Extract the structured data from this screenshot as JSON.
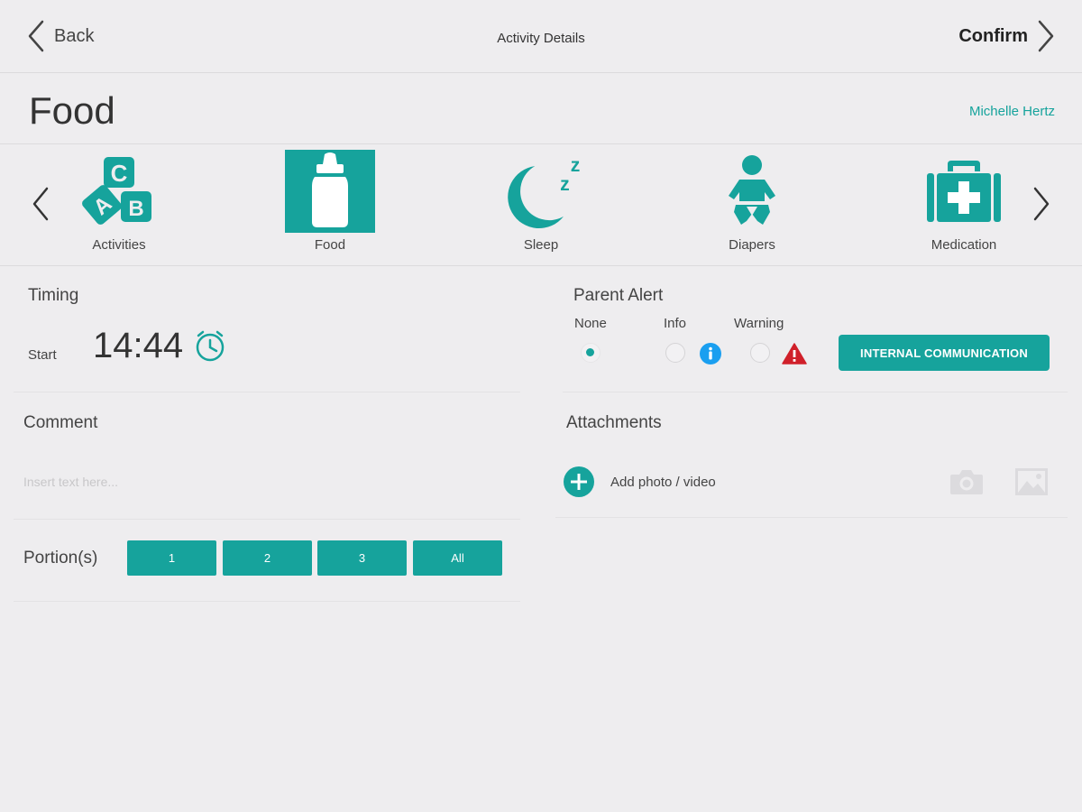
{
  "colors": {
    "accent": "#16a39c",
    "info": "#1a9ff0",
    "warning": "#d0202a"
  },
  "header": {
    "back_label": "Back",
    "title": "Activity Details",
    "confirm_label": "Confirm"
  },
  "title_row": {
    "title": "Food",
    "user": "Michelle Hertz"
  },
  "categories": [
    {
      "label": "Activities",
      "icon": "abc-blocks-icon",
      "selected": false
    },
    {
      "label": "Food",
      "icon": "baby-bottle-icon",
      "selected": true
    },
    {
      "label": "Sleep",
      "icon": "moon-sleep-icon",
      "selected": false
    },
    {
      "label": "Diapers",
      "icon": "baby-diaper-icon",
      "selected": false
    },
    {
      "label": "Medication",
      "icon": "medical-kit-icon",
      "selected": false
    }
  ],
  "timing": {
    "title": "Timing",
    "start_label": "Start",
    "time": "14:44"
  },
  "parent_alert": {
    "title": "Parent Alert",
    "options": [
      {
        "label": "None",
        "selected": true
      },
      {
        "label": "Info",
        "selected": false
      },
      {
        "label": "Warning",
        "selected": false
      }
    ],
    "internal_button": "INTERNAL COMMUNICATION"
  },
  "comment": {
    "title": "Comment",
    "placeholder": "Insert text here...",
    "value": ""
  },
  "attachments": {
    "title": "Attachments",
    "add_label": "Add photo / video"
  },
  "portions": {
    "title": "Portion(s)",
    "options": [
      "1",
      "2",
      "3",
      "All"
    ]
  }
}
